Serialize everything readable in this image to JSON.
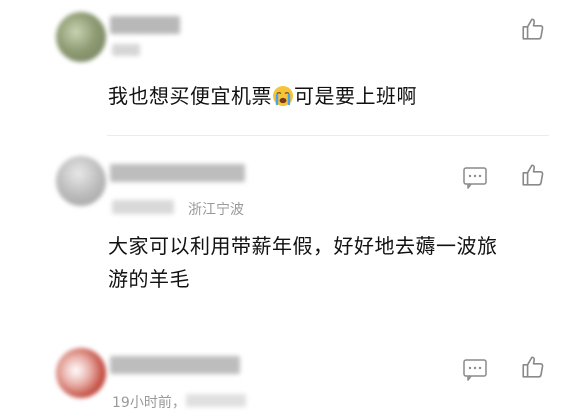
{
  "comments": [
    {
      "text_before": "我也想买便宜机票",
      "emoji": "crying-face",
      "text_after": "可是要上班啊"
    },
    {
      "location": "浙江宁波",
      "text_line1": "大家可以利用带薪年假，好好地去薅一波旅",
      "text_line2": "游的羊毛"
    },
    {
      "time": "19小时前，"
    }
  ],
  "colors": {
    "icon": "#8a8a8a",
    "meta": "#9a9a9a",
    "text": "#111111"
  }
}
